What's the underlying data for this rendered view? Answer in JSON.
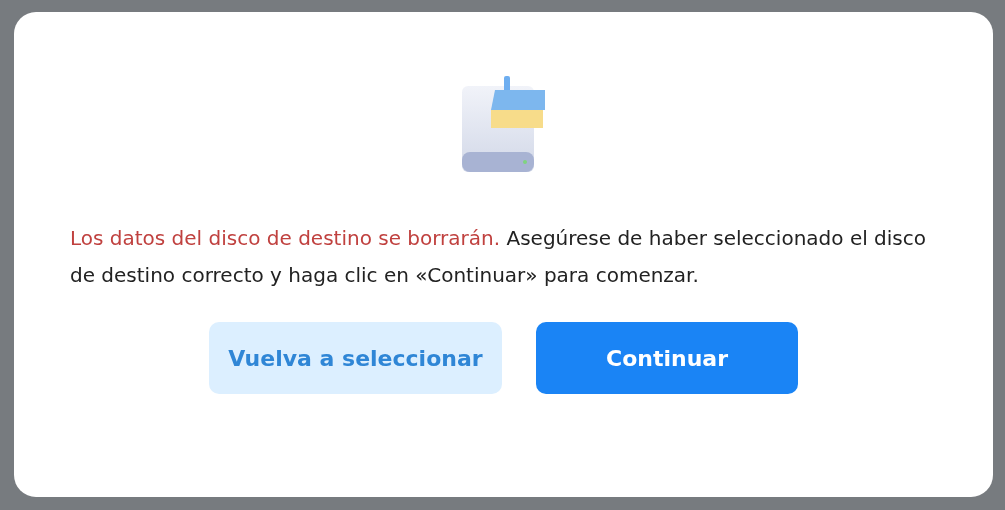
{
  "dialog": {
    "warning": "Los datos del disco de destino se borrarán.",
    "message": "Asegúrese de haber seleccionado el disco de destino correcto y haga clic en «Continuar» para comenzar.",
    "buttons": [
      {
        "label": "Vuelva a seleccionar",
        "kind": "secondary"
      },
      {
        "label": "Continuar",
        "kind": "primary"
      }
    ]
  }
}
